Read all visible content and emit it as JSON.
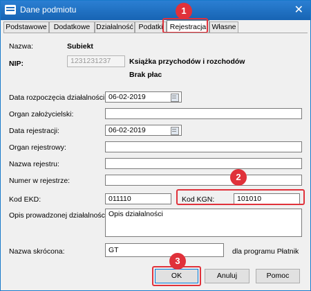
{
  "window": {
    "title": "Dane podmiotu"
  },
  "tabs": [
    "Podstawowe",
    "Dodatkowe",
    "Działalność",
    "Podatki",
    "Rejestracja",
    "Własne"
  ],
  "header": {
    "name_label": "Nazwa:",
    "name_value": "Subiekt",
    "nip_label": "NIP:",
    "nip_value": "1231231237",
    "info_line1": "Książka przychodów i rozchodów",
    "info_line2": "Brak płac"
  },
  "form": {
    "start_date_label": "Data rozpoczęcia działalności:",
    "start_date_value": "06-02-2019",
    "founder_label": "Organ założycielski:",
    "reg_date_label": "Data rejestracji:",
    "reg_date_value": "06-02-2019",
    "registry_org_label": "Organ rejestrowy:",
    "registry_name_label": "Nazwa rejestru:",
    "registry_number_label": "Numer w rejestrze:",
    "ekd_label": "Kod EKD:",
    "ekd_value": "011110",
    "kgn_label": "Kod KGN:",
    "kgn_value": "101010",
    "activity_desc_label": "Opis prowadzonej działalności:",
    "activity_desc_value": "Opis działalności",
    "short_name_label": "Nazwa skrócona:",
    "short_name_value": "GT",
    "short_name_hint": "dla programu Płatnik"
  },
  "buttons": {
    "ok": "OK",
    "cancel": "Anuluj",
    "help": "Pomoc"
  },
  "annotations": {
    "badge1": "1",
    "badge2": "2",
    "badge3": "3"
  },
  "colors": {
    "highlight": "#e0313a",
    "titlebar": "#1f6fc0"
  }
}
